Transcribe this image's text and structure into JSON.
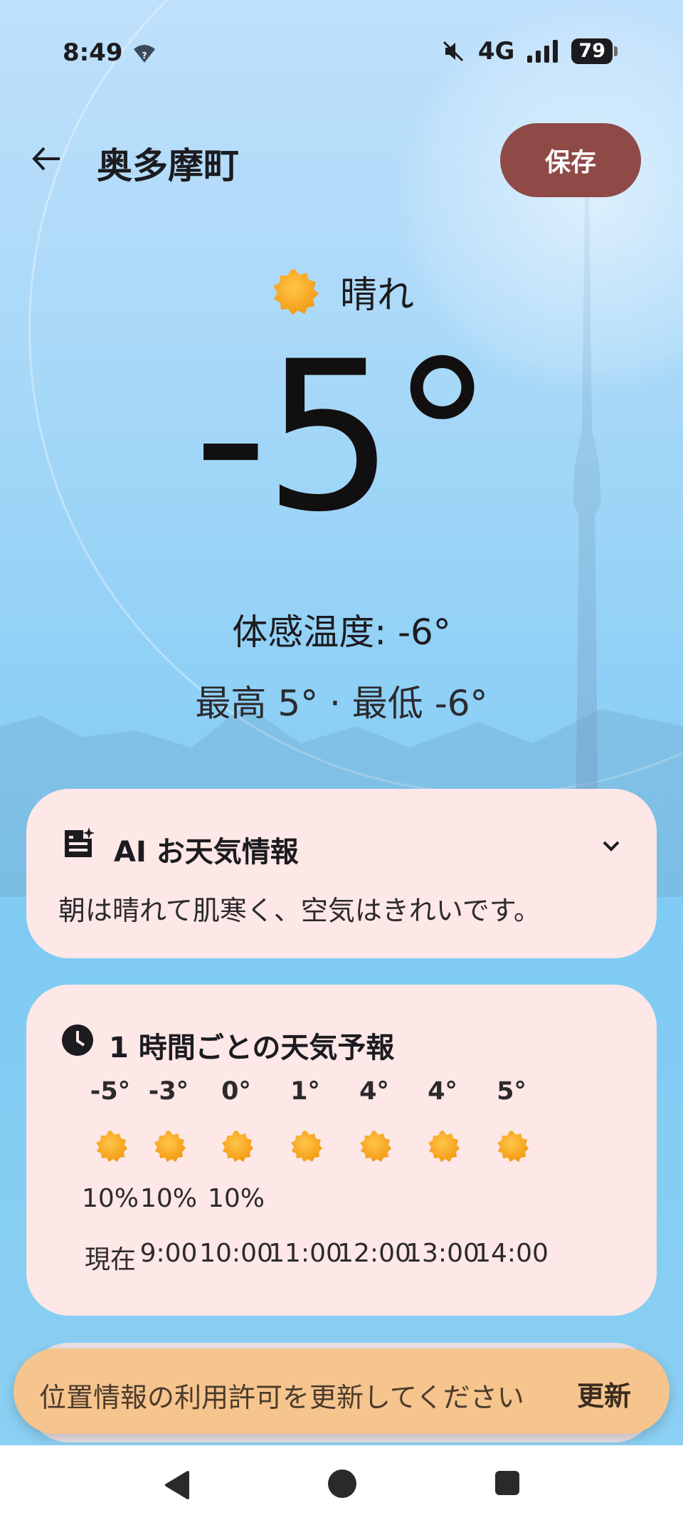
{
  "status_bar": {
    "time": "8:49",
    "network": "4G",
    "battery": "79",
    "icons": [
      "wifi-question-icon",
      "mute-icon",
      "signal-icon",
      "battery-icon"
    ]
  },
  "app_bar": {
    "location": "奥多摩町",
    "save_label": "保存"
  },
  "current": {
    "condition": "晴れ",
    "temperature": "-5°",
    "feels_like": "体感温度: -6°",
    "high_low": "最高 5° · 最低 -6°"
  },
  "ai_card": {
    "title": "AI お天気情報",
    "summary": "朝は晴れて肌寒く、空気はきれいです。"
  },
  "hourly": {
    "title": "1 時間ごとの天気予報",
    "items": [
      {
        "temp": "-5°",
        "pop": "10%",
        "time": "現在"
      },
      {
        "temp": "-3°",
        "pop": "10%",
        "time": "9:00"
      },
      {
        "temp": "0°",
        "pop": "10%",
        "time": "10:00"
      },
      {
        "temp": "1°",
        "pop": "",
        "time": "11:00"
      },
      {
        "temp": "4°",
        "pop": "",
        "time": "12:00"
      },
      {
        "temp": "4°",
        "pop": "",
        "time": "13:00"
      },
      {
        "temp": "5°",
        "pop": "",
        "time": "14:00"
      }
    ]
  },
  "snackbar": {
    "message": "位置情報の利用許可を更新してください",
    "action": "更新"
  },
  "colors": {
    "save_button": "#8f4a48",
    "card_bg": "#fde7e7",
    "snackbar_bg": "#f6c48d",
    "sun": "#f7a823"
  }
}
